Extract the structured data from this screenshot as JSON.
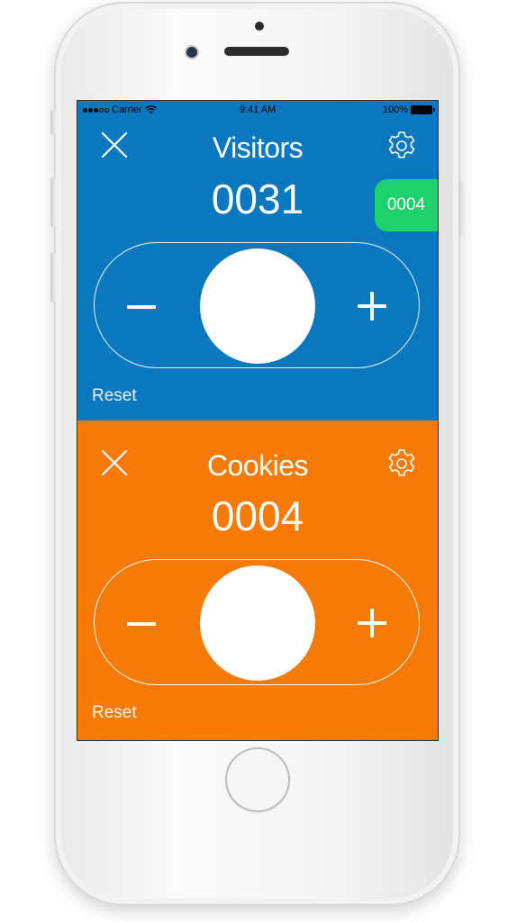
{
  "status_bar": {
    "carrier": "Carrier",
    "time": "9:41 AM",
    "battery": "100%"
  },
  "counters": [
    {
      "title": "Visitors",
      "count": "0031",
      "reset_label": "Reset",
      "minus_symbol": "−",
      "plus_symbol": "+",
      "color": "#0a78c0"
    },
    {
      "title": "Cookies",
      "count": "0004",
      "reset_label": "Reset",
      "minus_symbol": "−",
      "plus_symbol": "+",
      "color": "#f57a06"
    }
  ],
  "badge": {
    "value": "0004",
    "color": "#1cd36b"
  },
  "icons": {
    "close": "close-icon",
    "settings": "gear-icon",
    "wifi": "wifi-icon",
    "battery": "battery-icon"
  }
}
